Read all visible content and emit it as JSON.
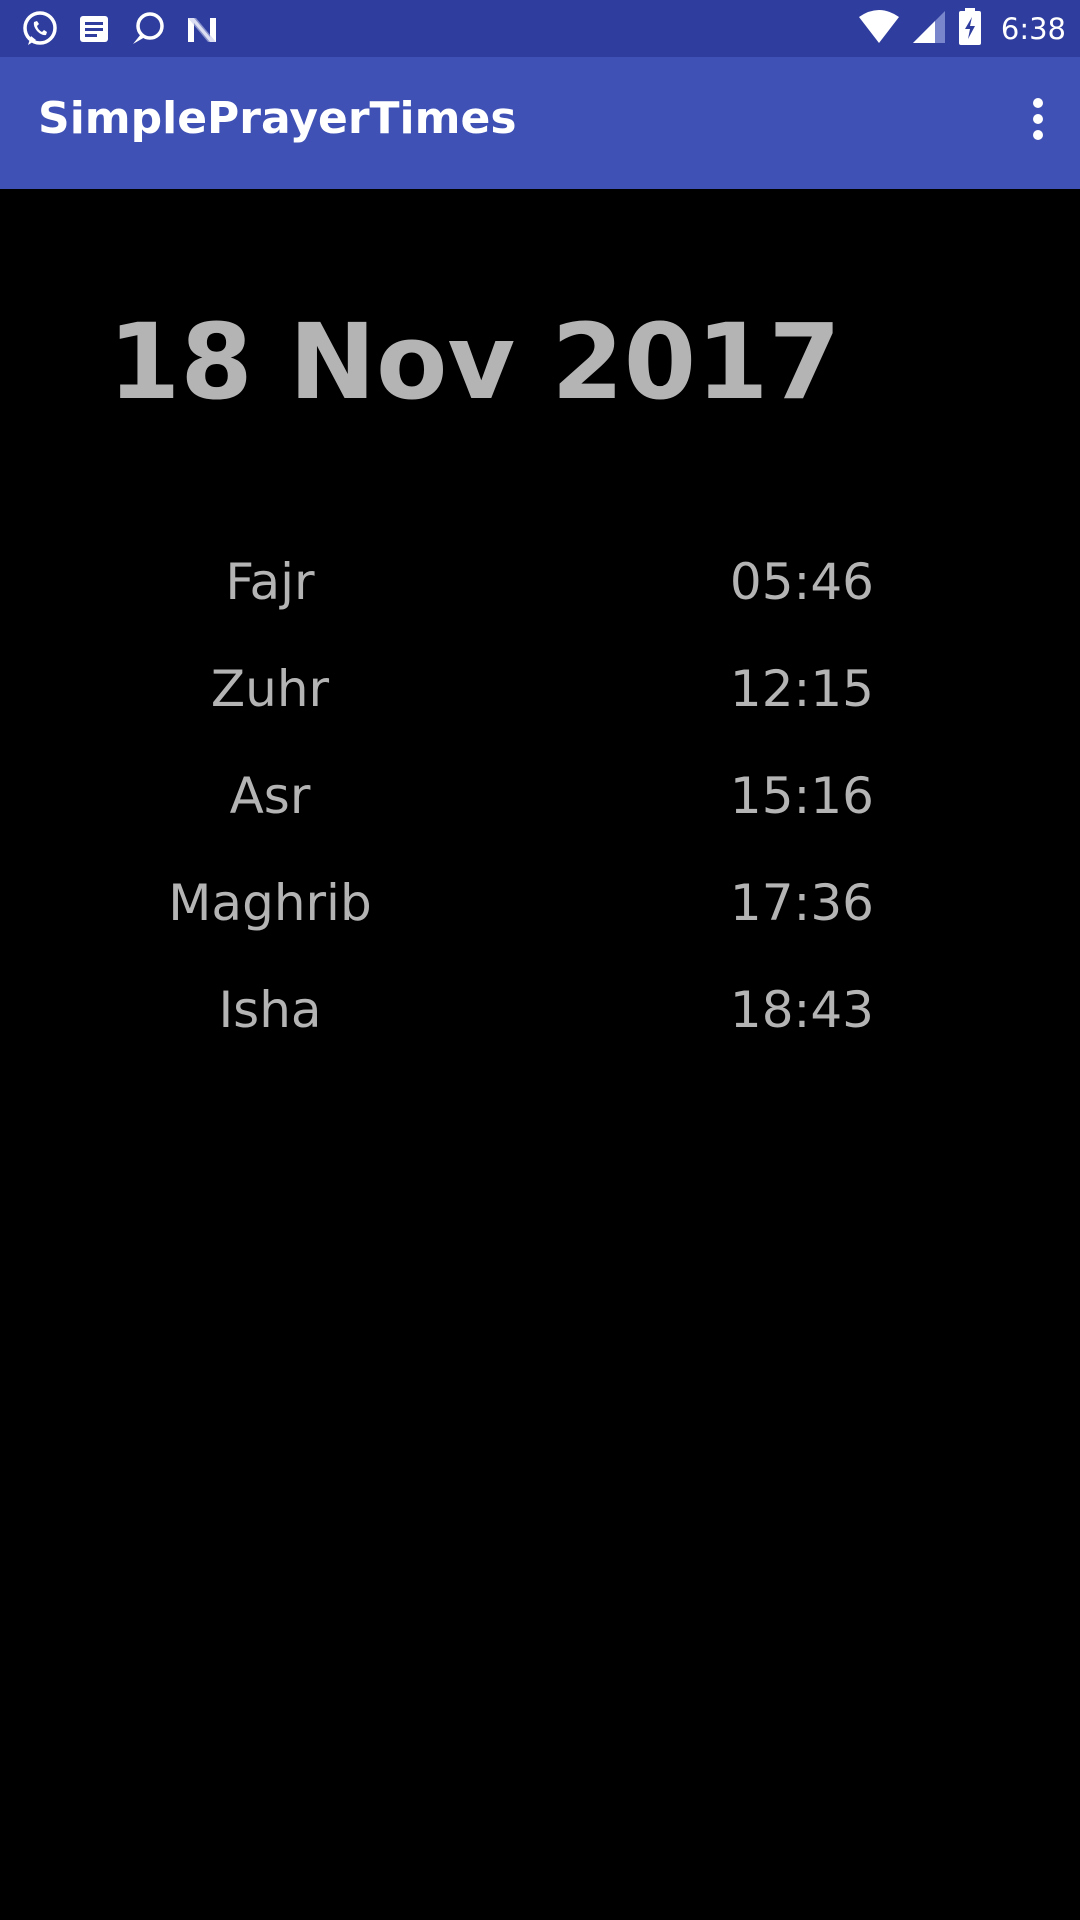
{
  "status_bar": {
    "time": "6:38",
    "left_icons": [
      "whatsapp-icon",
      "message-icon",
      "chat-bubble-icon",
      "n-logo-icon"
    ],
    "right_icons": [
      "wifi-icon",
      "cell-signal-icon",
      "battery-charging-icon"
    ],
    "background": "#2f3e9e"
  },
  "app_bar": {
    "title": "SimplePrayerTimes",
    "menu_icon": "overflow-menu-icon",
    "background": "#3f51b5"
  },
  "main": {
    "date": "18 Nov 2017",
    "prayers": [
      {
        "name": "Fajr",
        "time": "05:46"
      },
      {
        "name": "Zuhr",
        "time": "12:15"
      },
      {
        "name": "Asr",
        "time": "15:16"
      },
      {
        "name": "Maghrib",
        "time": "17:36"
      },
      {
        "name": "Isha",
        "time": "18:43"
      }
    ],
    "text_color": "#b4b4b4",
    "background": "#000000"
  }
}
